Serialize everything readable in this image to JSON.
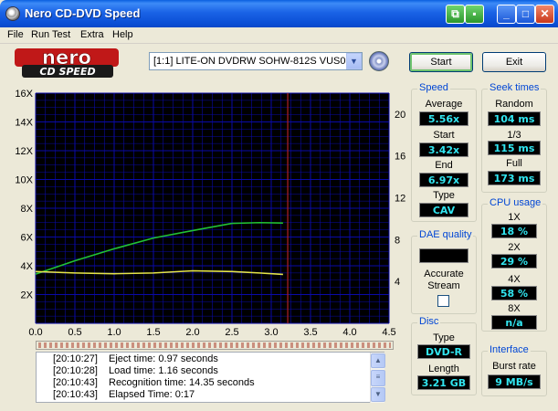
{
  "window": {
    "title": "Nero CD-DVD Speed"
  },
  "menu": [
    "File",
    "Run Test",
    "Extra",
    "Help"
  ],
  "logo": {
    "line1": "nero",
    "line2": "CD SPEED"
  },
  "toolbar": {
    "drive": "[1:1]  LITE-ON DVDRW SOHW-812S VUS0C",
    "start_label": "Start",
    "exit_label": "Exit"
  },
  "colors": {
    "accent": "#0046d5",
    "value_text": "#31e5f0",
    "chart_bg": "#000000",
    "grid": "#0a0aa8",
    "speed_line": "#22c234",
    "rpm_line": "#e4e44a",
    "marker": "#b22222"
  },
  "chart_data": {
    "type": "line",
    "x": [
      0.0,
      0.5,
      1.0,
      1.5,
      2.0,
      2.5,
      2.85,
      3.15
    ],
    "series": [
      {
        "values": [
          3.42,
          4.35,
          5.18,
          5.93,
          6.45,
          6.95,
          7.0,
          6.97
        ]
      },
      {
        "values": [
          3.6,
          3.5,
          3.45,
          3.5,
          3.65,
          3.6,
          3.5,
          3.4
        ]
      }
    ],
    "x_ticks": [
      "0.0",
      "0.5",
      "1.0",
      "1.5",
      "2.0",
      "2.5",
      "3.0",
      "3.5",
      "4.0",
      "4.5"
    ],
    "y_ticks_left": [
      "2X",
      "4X",
      "6X",
      "8X",
      "10X",
      "12X",
      "14X",
      "16X"
    ],
    "y_ticks_right": [
      "4",
      "8",
      "12",
      "16",
      "20"
    ],
    "xlim": [
      0,
      4.5
    ],
    "ylim": [
      0,
      16
    ],
    "y2lim": [
      0,
      22
    ],
    "marker_x": 3.21,
    "grid": true
  },
  "progress": {
    "fraction": 1.0
  },
  "log": [
    {
      "time": "[20:10:27]",
      "text": "Eject time: 0.97 seconds"
    },
    {
      "time": "[20:10:28]",
      "text": "Load time: 1.16 seconds"
    },
    {
      "time": "[20:10:43]",
      "text": "Recognition time: 14.35 seconds"
    },
    {
      "time": "[20:10:43]",
      "text": "Elapsed Time:  0:17"
    }
  ],
  "speed": {
    "title": "Speed",
    "average_label": "Average",
    "average": "5.56x",
    "start_label": "Start",
    "start": "3.42x",
    "end_label": "End",
    "end": "6.97x",
    "type_label": "Type",
    "type": "CAV"
  },
  "seek": {
    "title": "Seek times",
    "random_label": "Random",
    "random": "104 ms",
    "third_label": "1/3",
    "third": "115 ms",
    "full_label": "Full",
    "full": "173 ms"
  },
  "cpu": {
    "title": "CPU usage",
    "items": [
      {
        "label": "1X",
        "value": "18 %"
      },
      {
        "label": "2X",
        "value": "29 %"
      },
      {
        "label": "4X",
        "value": "58 %"
      },
      {
        "label": "8X",
        "value": "n/a"
      }
    ]
  },
  "dae": {
    "title": "DAE quality",
    "value": "",
    "accurate_label_1": "Accurate",
    "accurate_label_2": "Stream"
  },
  "disc": {
    "title": "Disc",
    "type_label": "Type",
    "type": "DVD-R",
    "length_label": "Length",
    "length": "3.21 GB"
  },
  "interface": {
    "title": "Interface",
    "burst_label": "Burst rate",
    "burst": "9 MB/s"
  }
}
